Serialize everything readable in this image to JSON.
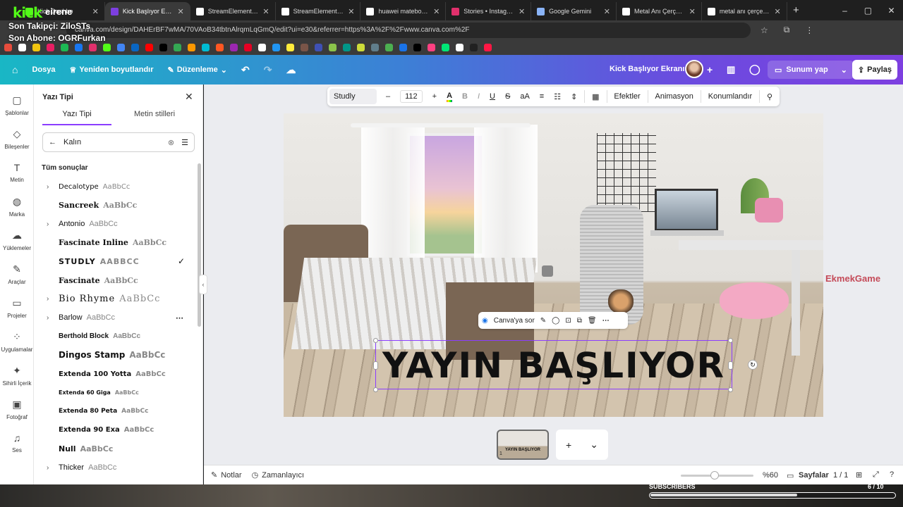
{
  "browser": {
    "tabs": [
      {
        "title": "Kick Dashbo",
        "color": "#53fc18"
      },
      {
        "title": "Kick Başlıyor Ekranı -",
        "color": "#7d3fe0",
        "active": true
      },
      {
        "title": "StreamElements - Ov",
        "color": "#ffffff"
      },
      {
        "title": "StreamElements - ee",
        "color": "#ffffff"
      },
      {
        "title": "huawei matebook d1",
        "color": "#ffffff"
      },
      {
        "title": "Stories • Instagram",
        "color": "#e1306c"
      },
      {
        "title": "Google Gemini",
        "color": "#8ab4f8"
      },
      {
        "title": "Metal Anı Çerçevesi",
        "color": "#ffffff"
      },
      {
        "title": "metal anı çerçevesi -",
        "color": "#ffffff"
      }
    ],
    "url": "canva.com/design/DAHErBF7wMA/70VAoB34tbtnAlrqmLqGmQ/edit?ui=e30&referrer=https%3A%2F%2Fwww.canva.com%2F",
    "bookmark_colors": [
      "#e74c3c",
      "#ffffff",
      "#f1c40f",
      "#e91e63",
      "#1db954",
      "#1877f2",
      "#e1306c",
      "#53fc18",
      "#4285f4",
      "#0a66c2",
      "#ff0000",
      "#000000",
      "#34a853",
      "#ff9800",
      "#00bcd4",
      "#ff5722",
      "#9c27b0",
      "#e60023",
      "#ffffff",
      "#2196f3",
      "#ffeb3b",
      "#795548",
      "#3f51b5",
      "#8bc34a",
      "#009688",
      "#cddc39",
      "#607d8b",
      "#4caf50",
      "#1a73e8",
      "#000000",
      "#ff4081",
      "#00e676",
      "#ffffff",
      "#212121",
      "#ff1744"
    ]
  },
  "overlay": {
    "brand": "kick",
    "username": "eirene",
    "last_follower": "Son Takipçi: ZiloSTs",
    "last_sub": "Son Abone: OGRFurkan",
    "subs_label": "SUBSCRIBERS",
    "subs_count": "6 / 10",
    "subs_progress": 0.6,
    "watermark": "EkmekGame"
  },
  "header": {
    "home_icon": "home-icon",
    "file": "Dosya",
    "resize": "Yeniden boyutlandır",
    "edit": "Düzenleme",
    "doc_title": "Kick Başlıyor Ekranı",
    "present": "Sunum yap",
    "share": "Paylaş"
  },
  "rail": [
    {
      "label": "Şablonlar",
      "icon": "▢"
    },
    {
      "label": "Bileşenler",
      "icon": "◇"
    },
    {
      "label": "Metin",
      "icon": "T"
    },
    {
      "label": "Marka",
      "icon": "◍"
    },
    {
      "label": "Yüklemeler",
      "icon": "☁"
    },
    {
      "label": "Araçlar",
      "icon": "✎"
    },
    {
      "label": "Projeler",
      "icon": "▭"
    },
    {
      "label": "Uygulamalar",
      "icon": "⁘"
    },
    {
      "label": "Sihirli İçerik",
      "icon": "✦"
    },
    {
      "label": "Fotoğraf",
      "icon": "▣"
    },
    {
      "label": "Ses",
      "icon": "♫"
    }
  ],
  "panel": {
    "title": "Yazı Tipi",
    "tab_font": "Yazı Tipi",
    "tab_styles": "Metin stilleri",
    "search_value": "Kalın",
    "results_heading": "Tüm sonuçlar",
    "fonts": [
      {
        "name": "Decalotype",
        "sample": "AaBbCc",
        "expand": true
      },
      {
        "name": "Sancreek",
        "sample": "AaBbCc"
      },
      {
        "name": "Antonio",
        "sample": "AaBbCc",
        "expand": true
      },
      {
        "name": "Fascinate Inline",
        "sample": "AaBbCc"
      },
      {
        "name": "STUDLY",
        "sample": "AABBCC",
        "selected": true
      },
      {
        "name": "Fascinate",
        "sample": "AaBbCc"
      },
      {
        "name": "Bio Rhyme",
        "sample": "AaBbCc",
        "expand": true
      },
      {
        "name": "Barlow",
        "sample": "AaBbCc",
        "expand": true,
        "more": true
      },
      {
        "name": "Berthold Block",
        "sample": "AaBbCc"
      },
      {
        "name": "Dingos Stamp",
        "sample": "AaBbCc"
      },
      {
        "name": "Extenda 100 Yotta",
        "sample": "AaBbCc"
      },
      {
        "name": "Extenda 60 Giga",
        "sample": "AaBbCc"
      },
      {
        "name": "Extenda 80 Peta",
        "sample": "AaBbCc"
      },
      {
        "name": "Extenda 90 Exa",
        "sample": "AaBbCc"
      },
      {
        "name": "Null",
        "sample": "AaBbCc"
      },
      {
        "name": "Thicker",
        "sample": "AaBbCc",
        "expand": true
      }
    ]
  },
  "toolbar": {
    "font": "Studly",
    "size": "112",
    "effects": "Efektler",
    "animate": "Animasyon",
    "position": "Konumlandır"
  },
  "canvas": {
    "text": "YAYIN BAŞLIYOR",
    "ask_canva": "Canva'ya sor"
  },
  "pages": {
    "thumb_label": "YAYIN BAŞLIYOR",
    "thumb_number": "1"
  },
  "footer": {
    "notes": "Notlar",
    "timer": "Zamanlayıcı",
    "zoom": "%60",
    "pages": "Sayfalar",
    "page_count": "1 / 1"
  }
}
